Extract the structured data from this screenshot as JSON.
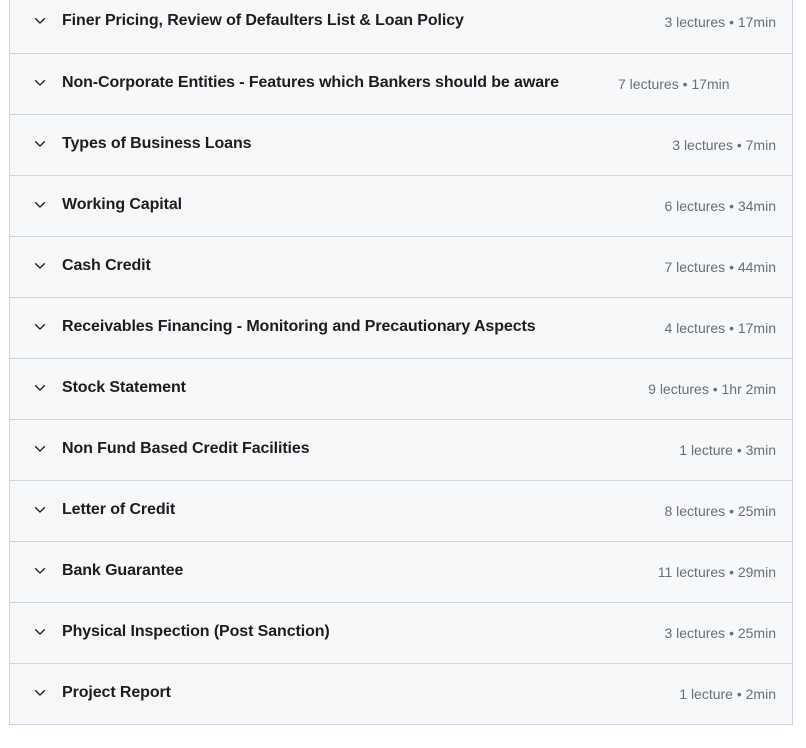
{
  "colors": {
    "row_background": "#f7f8fa",
    "border": "#d1d2e0",
    "title_text": "#1c1d1f",
    "meta_text": "#6a6f73"
  },
  "curriculum": {
    "chevron_icon": "chevron-down-icon",
    "sections": [
      {
        "title": "Finer Pricing, Review of Defaulters List & Loan Policy",
        "lectures": "3 lectures",
        "duration": "17min",
        "meta": "3 lectures • 17min",
        "wraps": false
      },
      {
        "title": "Non-Corporate Entities - Features which Bankers should be aware",
        "lectures": "7 lectures",
        "duration": "17min",
        "meta": "7 lectures • 17min",
        "wraps": true
      },
      {
        "title": "Types of Business Loans",
        "lectures": "3 lectures",
        "duration": "7min",
        "meta": "3 lectures • 7min",
        "wraps": false
      },
      {
        "title": "Working Capital",
        "lectures": "6 lectures",
        "duration": "34min",
        "meta": "6 lectures • 34min",
        "wraps": false
      },
      {
        "title": "Cash Credit",
        "lectures": "7 lectures",
        "duration": "44min",
        "meta": "7 lectures • 44min",
        "wraps": false
      },
      {
        "title": "Receivables Financing - Monitoring and Precautionary Aspects",
        "lectures": "4 lectures",
        "duration": "17min",
        "meta": "4 lectures • 17min",
        "wraps": false
      },
      {
        "title": "Stock Statement",
        "lectures": "9 lectures",
        "duration": "1hr 2min",
        "meta": "9 lectures • 1hr 2min",
        "wraps": false
      },
      {
        "title": "Non Fund Based Credit Facilities",
        "lectures": "1 lecture",
        "duration": "3min",
        "meta": "1 lecture • 3min",
        "wraps": false
      },
      {
        "title": "Letter of Credit",
        "lectures": "8 lectures",
        "duration": "25min",
        "meta": "8 lectures • 25min",
        "wraps": false
      },
      {
        "title": "Bank Guarantee",
        "lectures": "11 lectures",
        "duration": "29min",
        "meta": "11 lectures • 29min",
        "wraps": false
      },
      {
        "title": "Physical Inspection (Post Sanction)",
        "lectures": "3 lectures",
        "duration": "25min",
        "meta": "3 lectures • 25min",
        "wraps": false
      },
      {
        "title": "Project Report",
        "lectures": "1 lecture",
        "duration": "2min",
        "meta": "1 lecture • 2min",
        "wraps": false
      }
    ]
  }
}
